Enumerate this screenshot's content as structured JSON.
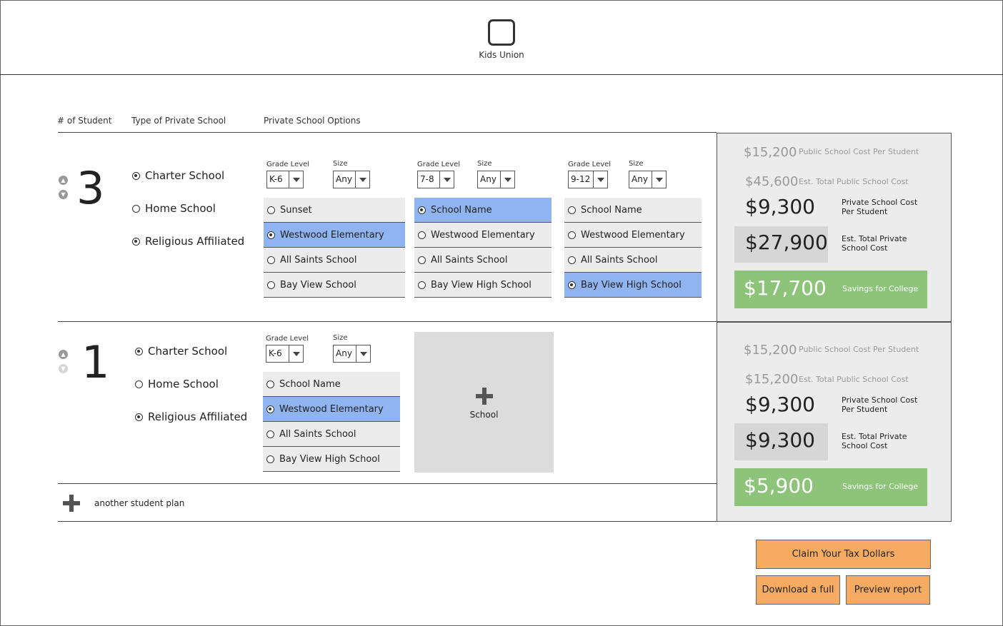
{
  "app": {
    "name": "Kids Union"
  },
  "headers": {
    "students": "# of Student",
    "school_type": "Type of Private School",
    "options": "Private School Options"
  },
  "labels": {
    "grade_level": "Grade Level",
    "size": "Size",
    "add_student": "another student plan",
    "add_school": "School"
  },
  "school_types": [
    "Charter School",
    "Home School",
    "Religious Affiliated"
  ],
  "plans": [
    {
      "count": "3",
      "type_selected": [
        true,
        false,
        true
      ],
      "columns": [
        {
          "grade": "K-6",
          "size": "Any",
          "options": [
            "Sunset",
            "Westwood Elementary",
            "All Saints School",
            "Bay View School"
          ],
          "selected": 1
        },
        {
          "grade": "7-8",
          "size": "Any",
          "options": [
            "School Name",
            "Westwood Elementary",
            "All Saints School",
            "Bay View High School"
          ],
          "selected": 0
        },
        {
          "grade": "9-12",
          "size": "Any",
          "options": [
            "School Name",
            "Westwood Elementary",
            "All Saints School",
            "Bay View High School"
          ],
          "selected": 3
        }
      ],
      "summary": {
        "public_cost": "$15,200",
        "public_cost_label": "Public School Cost Per Student",
        "public_total": "$45,600",
        "public_total_label": "Est. Total Public School Cost",
        "private_cost": "$9,300",
        "private_cost_label": "Private School Cost Per Student",
        "private_total": "$27,900",
        "private_total_label": "Est. Total Private School Cost",
        "savings": "$17,700",
        "savings_label": "Savings for College"
      }
    },
    {
      "count": "1",
      "type_selected": [
        true,
        false,
        true
      ],
      "columns": [
        {
          "grade": "K-6",
          "size": "Any",
          "options": [
            "School Name",
            "Westwood Elementary",
            "All Saints School",
            "Bay View High School"
          ],
          "selected": 1
        }
      ],
      "summary": {
        "public_cost": "$15,200",
        "public_cost_label": "Public School Cost Per Student",
        "public_total": "$15,200",
        "public_total_label": "Est. Total Public School Cost",
        "private_cost": "$9,300",
        "private_cost_label": "Private School Cost Per Student",
        "private_total": "$9,300",
        "private_total_label": "Est. Total Private School Cost",
        "savings": "$5,900",
        "savings_label": "Savings for College"
      }
    }
  ],
  "actions": {
    "claim": "Claim Your Tax Dollars",
    "download": "Download a full",
    "preview": "Preview report"
  },
  "colors": {
    "selected_option": "#8fb4ef",
    "savings": "#8dc47a",
    "action": "#f6ab63",
    "summary_bg": "#ececec"
  }
}
